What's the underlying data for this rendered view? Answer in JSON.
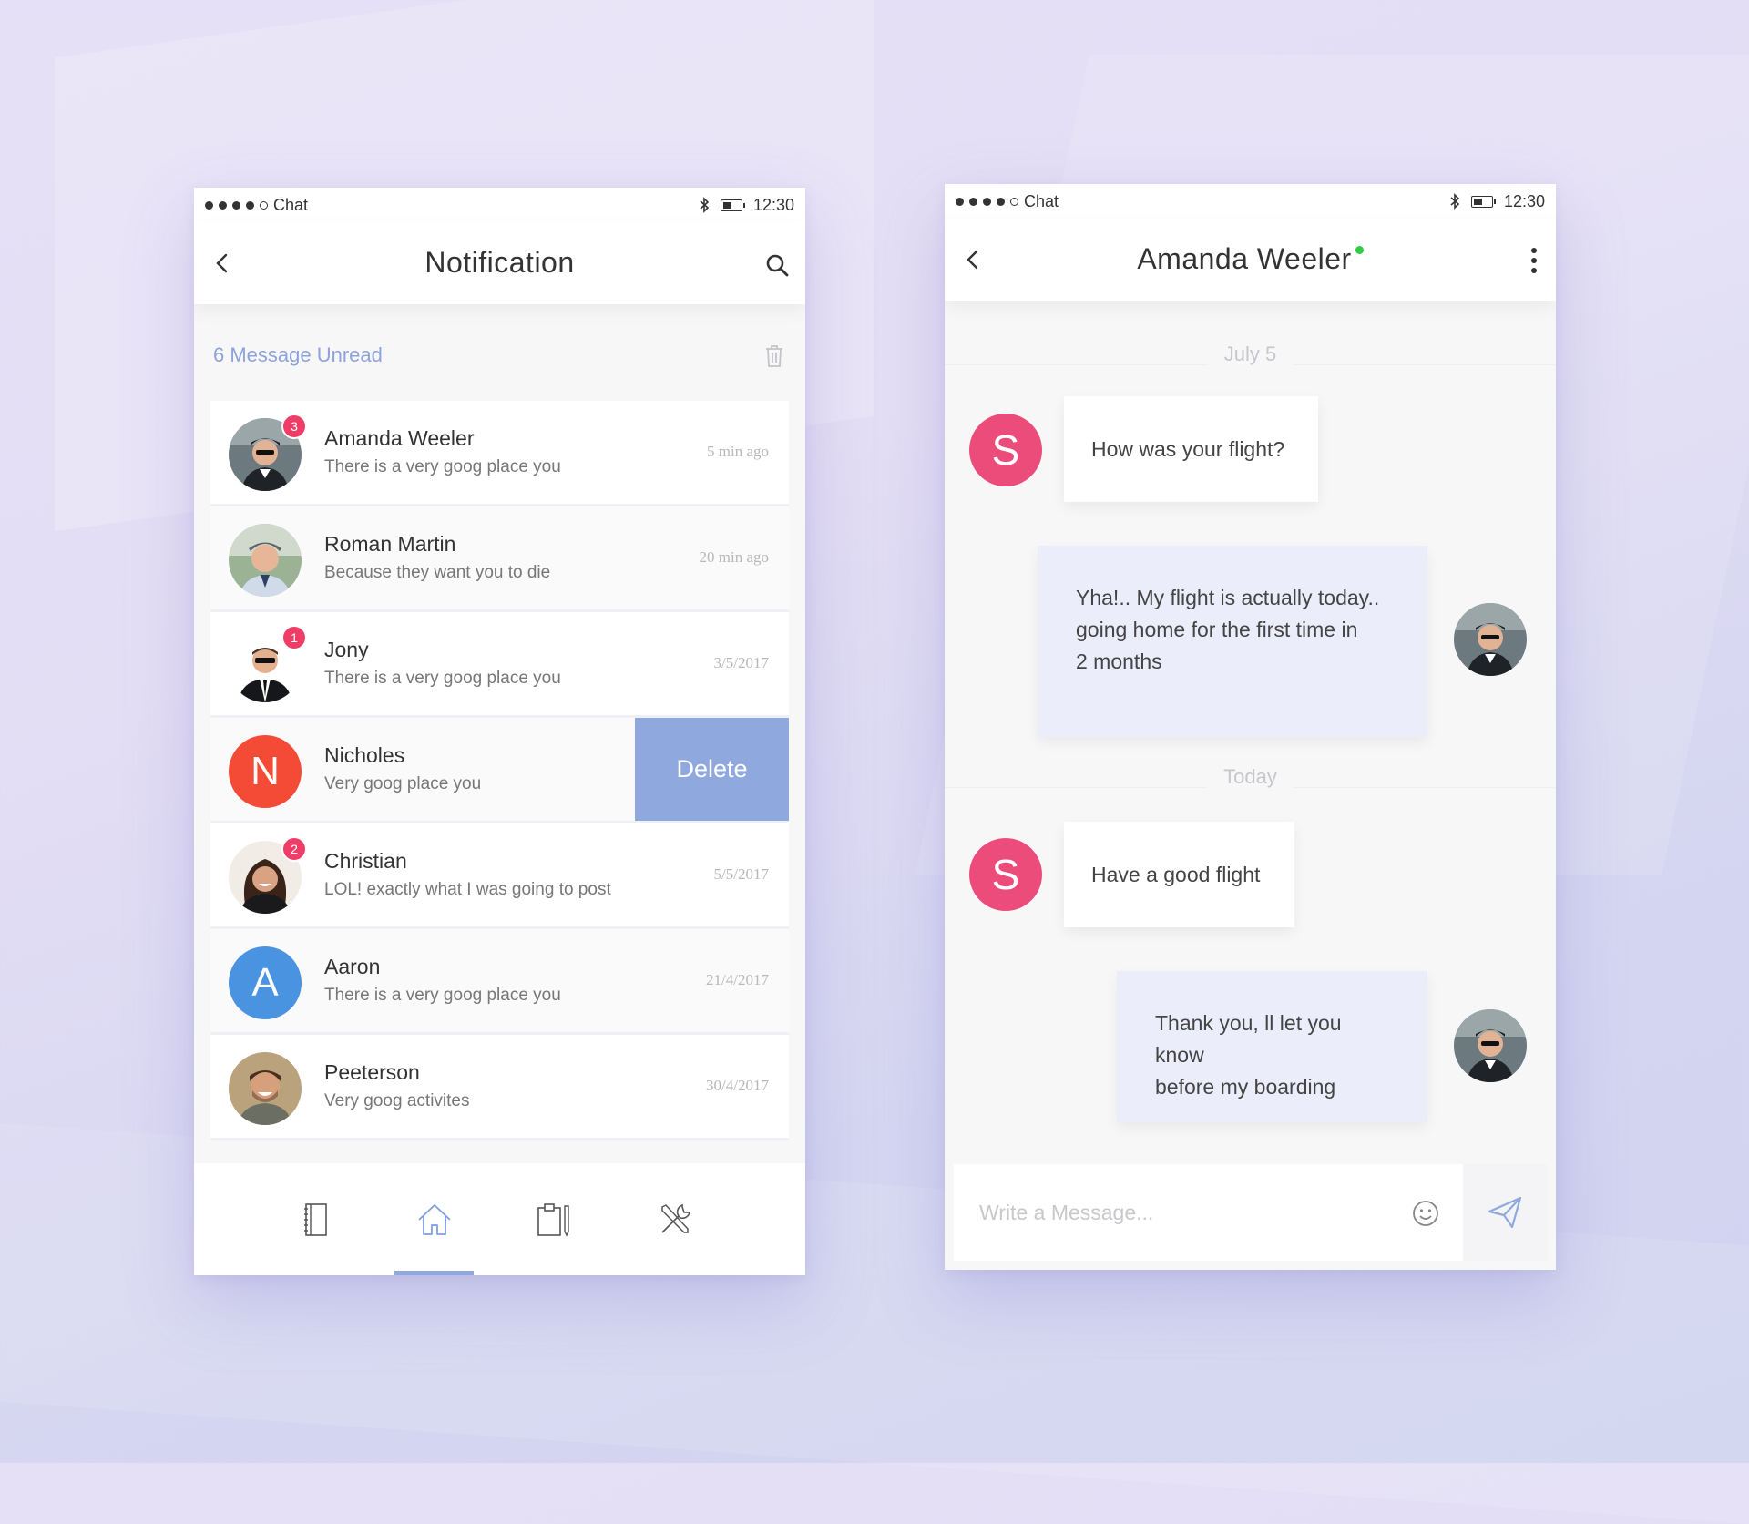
{
  "colors": {
    "accent": "#8fa8de",
    "badge": "#ee3d66",
    "avatar_pink": "#ec4c7a",
    "avatar_red": "#f44b36",
    "avatar_blue": "#4a93e0",
    "online": "#2ecc40",
    "outgoing_bubble": "#ecedfb"
  },
  "notification_screen": {
    "status": {
      "carrier": "Chat",
      "time": "12:30"
    },
    "title": "Notification",
    "unread_label": "6 Message Unread",
    "delete_label": "Delete",
    "items": [
      {
        "name": "Amanda Weeler",
        "preview": "There is a very goog place you",
        "time": "5 min ago",
        "badge": "3",
        "avatar": "photo-man-sunglasses"
      },
      {
        "name": "Roman Martin",
        "preview": "Because they want you to die",
        "time": "20 min ago",
        "badge": "",
        "avatar": "photo-man-cap"
      },
      {
        "name": "Jony",
        "preview": "There is a very goog place you",
        "time": "3/5/2017",
        "badge": "1",
        "avatar": "photo-man-suit"
      },
      {
        "name": "Nicholes",
        "preview": "Very goog place you",
        "time": "",
        "badge": "",
        "avatar_letter": "N"
      },
      {
        "name": "Christian",
        "preview": "LOL! exactly what I was going to post",
        "time": "5/5/2017",
        "badge": "2",
        "avatar": "photo-woman"
      },
      {
        "name": "Aaron",
        "preview": "There is a very goog place you",
        "time": "21/4/2017",
        "badge": "",
        "avatar_letter": "A"
      },
      {
        "name": "Peeterson",
        "preview": "Very goog activites",
        "time": "30/4/2017",
        "badge": "",
        "avatar": "photo-man-smiling"
      }
    ],
    "tabs": [
      {
        "icon": "notebook-icon",
        "active": false
      },
      {
        "icon": "home-icon",
        "active": true
      },
      {
        "icon": "clipboard-icon",
        "active": false
      },
      {
        "icon": "tools-icon",
        "active": false
      }
    ]
  },
  "chat_screen": {
    "status": {
      "carrier": "Chat",
      "time": "12:30"
    },
    "contact_name": "Amanda Weeler",
    "online": true,
    "date_1": "July 5",
    "date_2": "Today",
    "messages": [
      {
        "direction": "in",
        "avatar_letter": "S",
        "lines": [
          "How was your flight?"
        ]
      },
      {
        "direction": "out",
        "lines": [
          "Yha!.. My flight is actually today..",
          "going home for the first time in",
          "2 months"
        ]
      },
      {
        "direction": "in",
        "avatar_letter": "S",
        "lines": [
          "Have a good flight"
        ]
      },
      {
        "direction": "out",
        "lines": [
          "Thank you, ll let you know",
          "before my boarding"
        ]
      }
    ],
    "composer_placeholder": "Write a Message..."
  }
}
